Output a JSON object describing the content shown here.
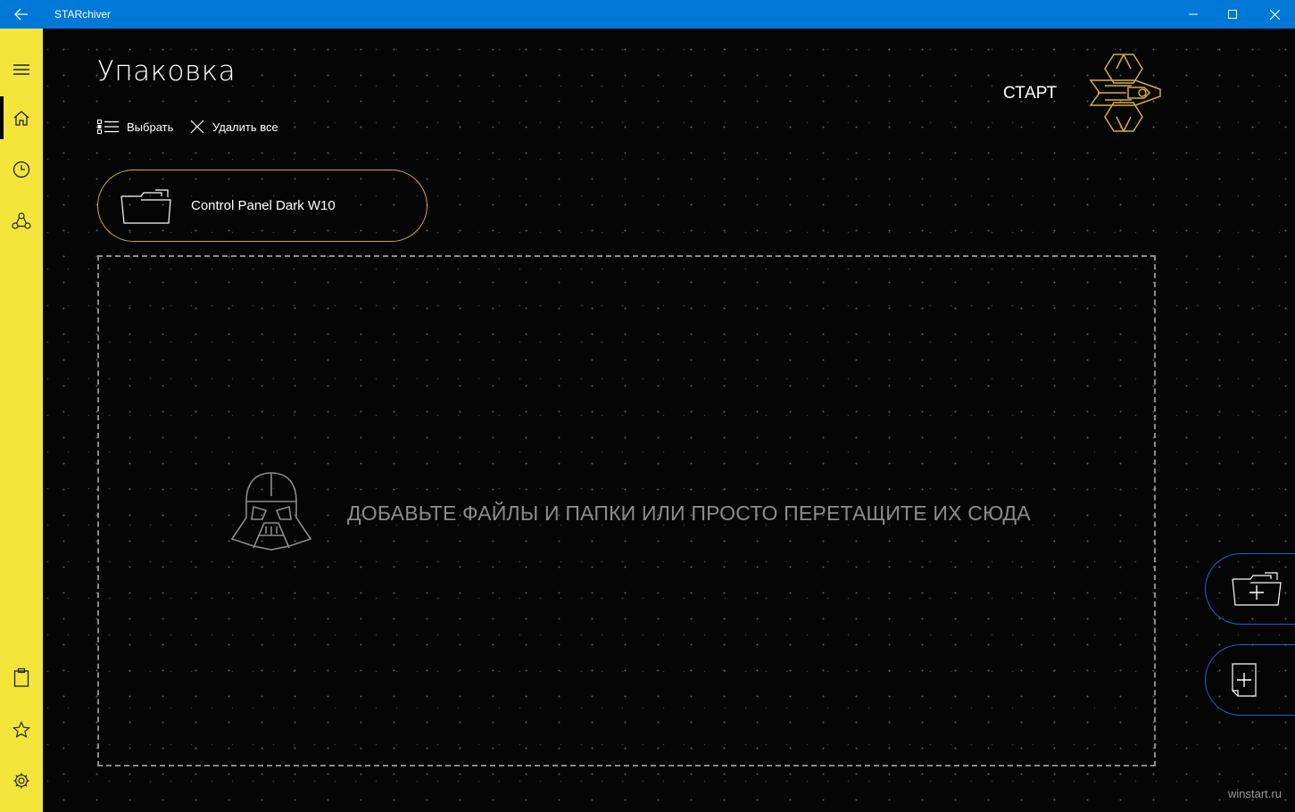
{
  "window": {
    "title": "STARchiver"
  },
  "page": {
    "title": "Упаковка"
  },
  "commands": {
    "select": "Выбрать",
    "delete_all": "Удалить все"
  },
  "start": {
    "label": "СТАРТ"
  },
  "files": [
    {
      "name": "Control Panel Dark W10"
    }
  ],
  "dropzone": {
    "hint": "ДОБАВЬТЕ ФАЙЛЫ И ПАПКИ ИЛИ ПРОСТО ПЕРЕТАЩИТЕ ИХ СЮДА"
  },
  "sidebar": {
    "items": [
      {
        "icon": "hamburger-menu-icon"
      },
      {
        "icon": "home-icon",
        "active": true
      },
      {
        "icon": "clock-icon"
      },
      {
        "icon": "share-icon"
      },
      {
        "icon": "clipboard-icon"
      },
      {
        "icon": "star-icon"
      },
      {
        "icon": "gear-icon"
      }
    ]
  },
  "actions": [
    {
      "icon": "add-folder-icon"
    },
    {
      "icon": "add-file-icon"
    }
  ],
  "watermark": "winstart.ru",
  "colors": {
    "titlebar": "#0078d7",
    "sidebar": "#f4e53b",
    "accent_gold": "#c9a93a",
    "fab_border": "#1f5fd0"
  }
}
